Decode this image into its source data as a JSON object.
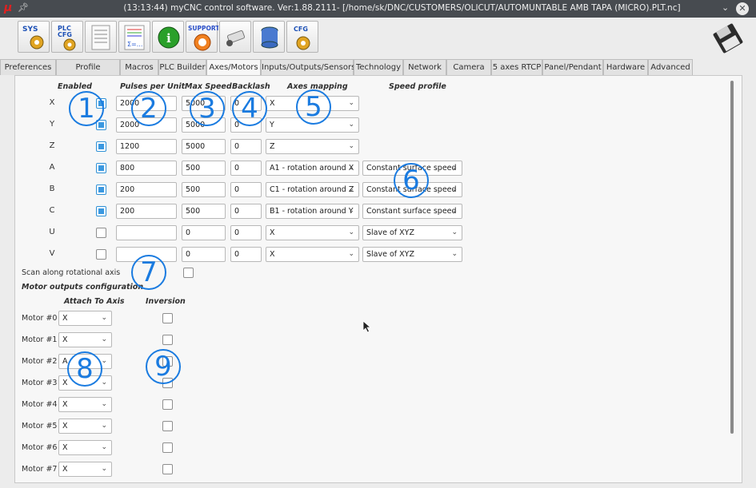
{
  "window": {
    "title": "(13:13:44) myCNC control software. Ver:1.88.2111- [/home/sk/DNC/CUSTOMERS/OLICUT/AUTOMUNTABLE AMB TAPA (MICRO).PLT.nc]",
    "logo": "μ",
    "pin_icon": "pin-icon",
    "chevron": "⌄",
    "close": "✕"
  },
  "toolbar": {
    "buttons": [
      {
        "name": "sys-config-icon",
        "label": "SYS"
      },
      {
        "name": "plc-config-icon",
        "label": "PLC CFG"
      },
      {
        "name": "document-list-icon",
        "label": ""
      },
      {
        "name": "macro-editor-icon",
        "label": "Σ=..."
      },
      {
        "name": "info-icon",
        "label": "i"
      },
      {
        "name": "support-icon",
        "label": "SUPPORT"
      },
      {
        "name": "camera-icon",
        "label": ""
      },
      {
        "name": "database-icon",
        "label": ""
      },
      {
        "name": "cfg-icon",
        "label": "CFG"
      }
    ],
    "save_icon": "floppy-save-icon"
  },
  "tabs": [
    {
      "label": "Preferences",
      "active": false
    },
    {
      "label": "Profile",
      "active": false
    },
    {
      "label": "Macros",
      "active": false
    },
    {
      "label": "PLC Builder",
      "active": false
    },
    {
      "label": "Axes/Motors",
      "active": true
    },
    {
      "label": "Inputs/Outputs/Sensors",
      "active": false
    },
    {
      "label": "Technology",
      "active": false
    },
    {
      "label": "Network",
      "active": false
    },
    {
      "label": "Camera",
      "active": false
    },
    {
      "label": "5 axes RTCP",
      "active": false
    },
    {
      "label": "Panel/Pendant",
      "active": false
    },
    {
      "label": "Hardware",
      "active": false
    },
    {
      "label": "Advanced",
      "active": false
    }
  ],
  "headers": {
    "enabled": "Enabled",
    "pulses": "Pulses per Unit",
    "max_speed": "Max Speed",
    "backlash": "Backlash",
    "mapping": "Axes mapping",
    "speed_profile": "Speed profile"
  },
  "axes": [
    {
      "axis": "X",
      "enabled": true,
      "pulses": "2000",
      "max_speed": "5000",
      "backlash": "0",
      "mapping": "X",
      "profile": ""
    },
    {
      "axis": "Y",
      "enabled": true,
      "pulses": "2000",
      "max_speed": "5000",
      "backlash": "0",
      "mapping": "Y",
      "profile": ""
    },
    {
      "axis": "Z",
      "enabled": true,
      "pulses": "1200",
      "max_speed": "5000",
      "backlash": "0",
      "mapping": "Z",
      "profile": ""
    },
    {
      "axis": "A",
      "enabled": true,
      "pulses": "800",
      "max_speed": "500",
      "backlash": "0",
      "mapping": "A1 - rotation around X",
      "profile": "Constant surface speed"
    },
    {
      "axis": "B",
      "enabled": true,
      "pulses": "200",
      "max_speed": "500",
      "backlash": "0",
      "mapping": "C1 - rotation around Z",
      "profile": "Constant surface speed"
    },
    {
      "axis": "C",
      "enabled": true,
      "pulses": "200",
      "max_speed": "500",
      "backlash": "0",
      "mapping": "B1 - rotation around Y",
      "profile": "Constant surface speed"
    },
    {
      "axis": "U",
      "enabled": false,
      "pulses": "",
      "max_speed": "0",
      "backlash": "0",
      "mapping": "X",
      "profile": "Slave of XYZ"
    },
    {
      "axis": "V",
      "enabled": false,
      "pulses": "",
      "max_speed": "0",
      "backlash": "0",
      "mapping": "X",
      "profile": "Slave of XYZ"
    }
  ],
  "scan_rotational": {
    "label": "Scan along rotational axis",
    "checked": false
  },
  "motor_section": {
    "title": "Motor outputs configuration",
    "attach_header": "Attach To Axis",
    "inversion_header": "Inversion"
  },
  "motors": [
    {
      "label": "Motor #0",
      "axis": "X",
      "inverted": false
    },
    {
      "label": "Motor #1",
      "axis": "X",
      "inverted": false
    },
    {
      "label": "Motor #2",
      "axis": "A",
      "inverted": false
    },
    {
      "label": "Motor #3",
      "axis": "X",
      "inverted": false
    },
    {
      "label": "Motor #4",
      "axis": "X",
      "inverted": false
    },
    {
      "label": "Motor #5",
      "axis": "X",
      "inverted": false
    },
    {
      "label": "Motor #6",
      "axis": "X",
      "inverted": false
    },
    {
      "label": "Motor #7",
      "axis": "X",
      "inverted": false
    }
  ],
  "callouts": [
    "1",
    "2",
    "3",
    "4",
    "5",
    "6",
    "7",
    "8",
    "9"
  ],
  "colors": {
    "accent": "#1a7be0",
    "checked": "#3a98e0",
    "titlebar": "#474b50"
  }
}
